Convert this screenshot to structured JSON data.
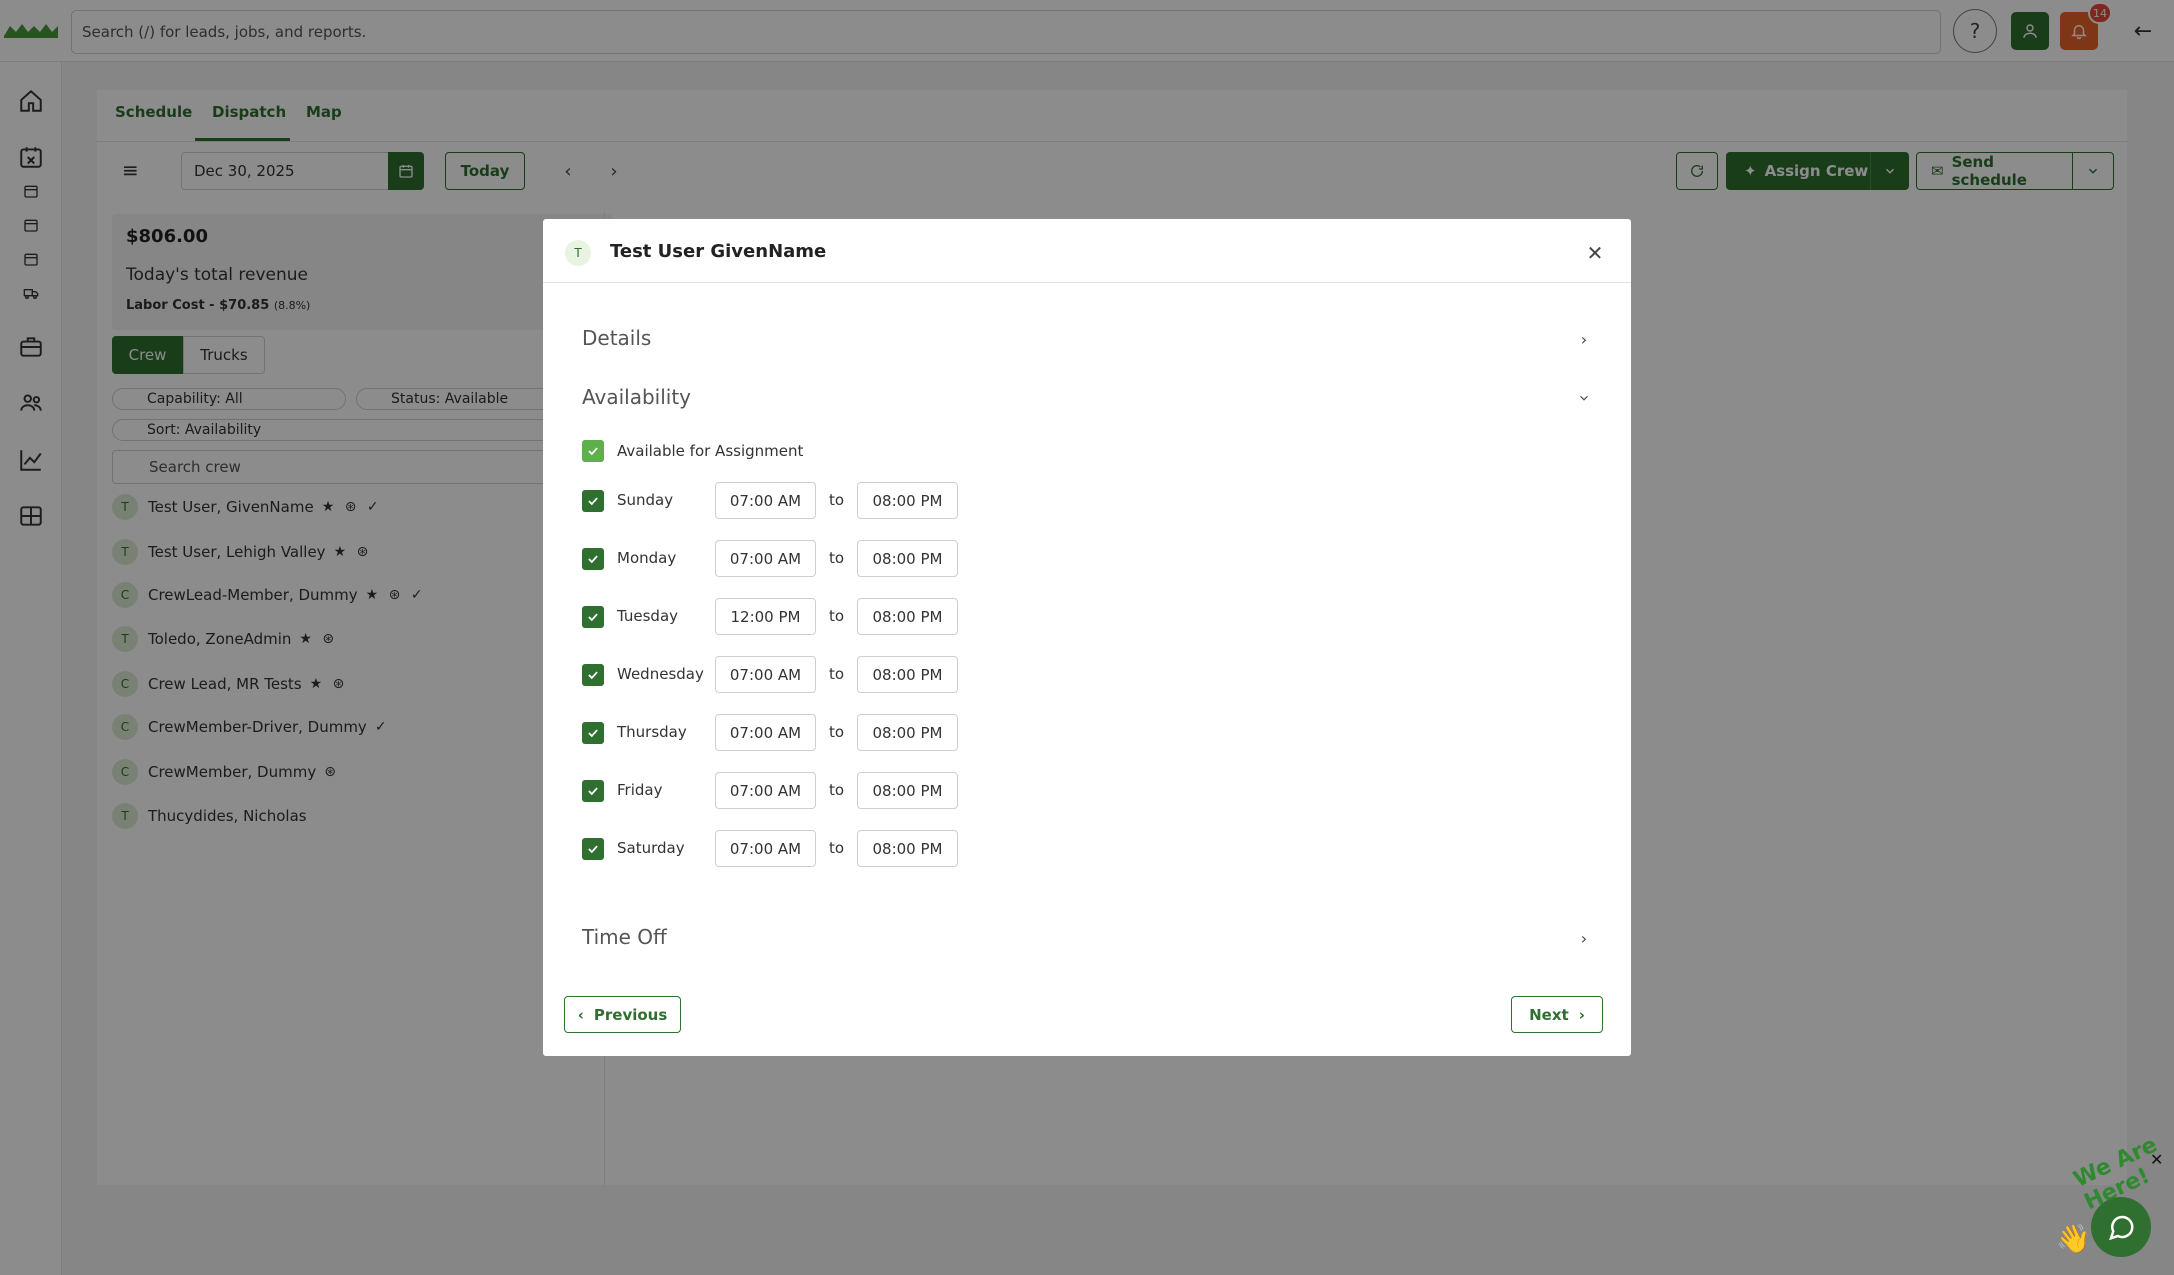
{
  "topbar": {
    "search_placeholder": "Search (/) for leads, jobs, and reports.",
    "help_label": "?",
    "notification_count": "14"
  },
  "tabs": [
    {
      "label": "Schedule"
    },
    {
      "label": "Dispatch"
    },
    {
      "label": "Map"
    }
  ],
  "toolbar": {
    "date": "Dec 30, 2025",
    "today_label": "Today",
    "assign_crew_label": "Assign Crew",
    "send_schedule_label": "Send schedule"
  },
  "revenue": {
    "amount": "$806.00",
    "label": "Today's total revenue",
    "labor_cost": "Labor Cost - $70.85",
    "labor_pct": "(8.8%)"
  },
  "segments": {
    "crew": "Crew",
    "trucks": "Trucks"
  },
  "filters": {
    "capability": "Capability: All",
    "status": "Status: Available",
    "sort": "Sort: Availability",
    "search_placeholder": "Search crew"
  },
  "crew": [
    {
      "initial": "T",
      "name": "Test User, GivenName",
      "icons": "★ ⊛ ✓"
    },
    {
      "initial": "T",
      "name": "Test User, Lehigh Valley",
      "icons": "★ ⊛"
    },
    {
      "initial": "C",
      "name": "CrewLead-Member, Dummy",
      "icons": "★ ⊛ ✓"
    },
    {
      "initial": "T",
      "name": "Toledo, ZoneAdmin",
      "icons": "★ ⊛"
    },
    {
      "initial": "C",
      "name": "Crew Lead, MR Tests",
      "icons": "★ ⊛"
    },
    {
      "initial": "C",
      "name": "CrewMember-Driver, Dummy",
      "icons": "✓"
    },
    {
      "initial": "C",
      "name": "CrewMember, Dummy",
      "icons": "⊛"
    },
    {
      "initial": "T",
      "name": "Thucydides, Nicholas",
      "icons": ""
    }
  ],
  "modal": {
    "avatar_initial": "T",
    "title": "Test User GivenName",
    "details_label": "Details",
    "availability_label": "Availability",
    "available_for_assignment": "Available for Assignment",
    "to_label": "to",
    "days": [
      {
        "day": "Sunday",
        "start": "07:00 AM",
        "end": "08:00 PM"
      },
      {
        "day": "Monday",
        "start": "07:00 AM",
        "end": "08:00 PM"
      },
      {
        "day": "Tuesday",
        "start": "12:00 PM",
        "end": "08:00 PM"
      },
      {
        "day": "Wednesday",
        "start": "07:00 AM",
        "end": "08:00 PM"
      },
      {
        "day": "Thursday",
        "start": "07:00 AM",
        "end": "08:00 PM"
      },
      {
        "day": "Friday",
        "start": "07:00 AM",
        "end": "08:00 PM"
      },
      {
        "day": "Saturday",
        "start": "07:00 AM",
        "end": "08:00 PM"
      }
    ],
    "time_off_label": "Time Off",
    "previous_label": "Previous",
    "next_label": "Next"
  },
  "chat": {
    "label": "We Are Here!"
  },
  "colors": {
    "brand_green": "#2f6f2f",
    "notification_orange": "#e8632b",
    "check_light_green": "#5fb04d"
  }
}
